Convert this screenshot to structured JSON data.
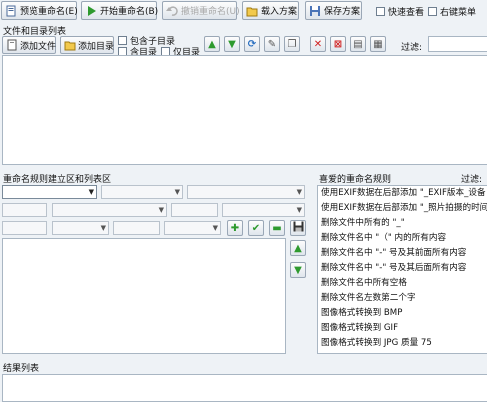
{
  "toolbar": {
    "preview": "预览重命名(E)",
    "start": "开始重命名(B)",
    "undo": "撤销重命名(U)",
    "load": "载入方案",
    "save": "保存方案",
    "quick_view": "快速查看",
    "context_menu": "右键菜单"
  },
  "files": {
    "section_title": "文件和目录列表",
    "add_file": "添加文件",
    "add_dir": "添加目录",
    "opt_include_sub": "包含子目录",
    "opt_include_dir": "含目录",
    "opt_only_dir": "仅目录",
    "filter_label": "过滤:"
  },
  "rules": {
    "section_title": "重命名规则建立区和列表区",
    "favorites_title": "喜爱的重命名规则",
    "favorites_filter": "过滤:",
    "favorites": [
      "使用EXIF数据在后部添加 \"_EXIF版本_设备",
      "使用EXIF数据在后部添加 \"_照片拍摄的时间",
      "删除文件中所有的 \"_\"",
      "删除文件名中 \"（\" 内的所有内容",
      "删除文件名中 \"-\" 号及其前面所有内容",
      "删除文件名中 \"-\" 号及其后面所有内容",
      "删除文件名中所有空格",
      "删除文件名左数第二个字",
      "图像格式转换到 BMP",
      "图像格式转换到 GIF",
      "图像格式转换到 JPG 质量 75"
    ]
  },
  "results": {
    "section_title": "结果列表"
  },
  "colors": {
    "green": "#2e9a2e",
    "red": "#d02020",
    "accent": "#2a6fc0"
  }
}
